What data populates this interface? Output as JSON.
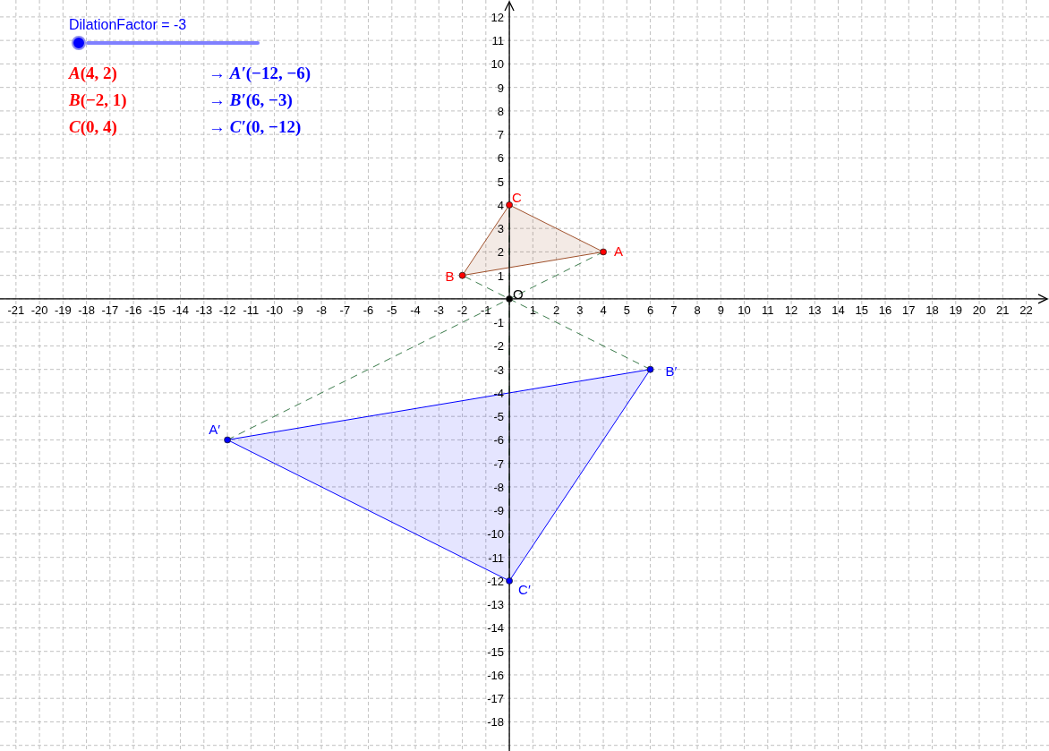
{
  "slider": {
    "label": "DilationFactor = -3",
    "level": 0
  },
  "mappings": [
    {
      "original": "*A*(4, 2)",
      "image": "→ *A′*(−12, −6)"
    },
    {
      "original": "*B*(−2, 1)",
      "image": "→ *B′*(6, −3)"
    },
    {
      "original": "*C*(0, 4)",
      "image": "→ *C′*(0, −12)"
    }
  ],
  "plane": {
    "chart_data": {
      "type": "scatter",
      "grid": true,
      "xlim": [
        -21.68,
        22.97
      ],
      "ylim": [
        -19.24,
        12.72
      ],
      "xticks": [
        -21,
        -20,
        -19,
        -18,
        -17,
        -16,
        -15,
        -14,
        -13,
        -12,
        -11,
        -10,
        -9,
        -8,
        -7,
        -6,
        -5,
        -4,
        -3,
        -2,
        -1,
        1,
        2,
        3,
        4,
        5,
        6,
        7,
        8,
        9,
        10,
        11,
        12,
        13,
        14,
        15,
        16,
        17,
        18,
        19,
        20,
        21,
        22
      ],
      "yticks": [
        -18,
        -17,
        -16,
        -15,
        -14,
        -13,
        -12,
        -11,
        -10,
        -9,
        -8,
        -7,
        -6,
        -5,
        -4,
        -3,
        -2,
        -1,
        1,
        2,
        3,
        4,
        5,
        6,
        7,
        8,
        9,
        10,
        11,
        12
      ],
      "x": [
        4,
        -2,
        0,
        -12,
        6,
        0,
        0
      ],
      "series": [
        {
          "color": "#ff0000",
          "values": [
            2,
            1,
            4,
            null,
            null,
            null,
            null
          ]
        },
        {
          "color": "#0000ff",
          "values": [
            null,
            null,
            null,
            -6,
            -3,
            -12,
            null
          ]
        },
        {
          "color": "#000000",
          "values": [
            null,
            null,
            null,
            null,
            null,
            null,
            0
          ]
        }
      ],
      "annotations": [
        {
          "text": "A",
          "x": 4,
          "y": 2
        },
        {
          "text": "B",
          "x": -2,
          "y": 1
        },
        {
          "text": "C",
          "x": 0,
          "y": 4
        },
        {
          "text": "A′",
          "x": -12,
          "y": -6
        },
        {
          "text": "B′",
          "x": 6,
          "y": -3
        },
        {
          "text": "C′",
          "x": 0,
          "y": -12
        },
        {
          "text": "O",
          "x": 0,
          "y": 0
        }
      ]
    }
  }
}
